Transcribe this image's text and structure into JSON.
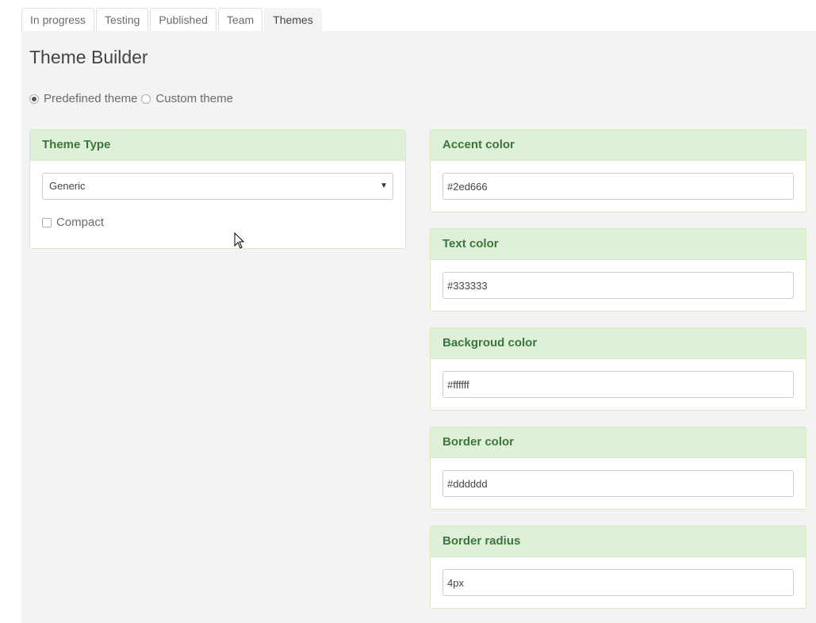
{
  "tabs": [
    {
      "label": "In progress",
      "active": false
    },
    {
      "label": "Testing",
      "active": false
    },
    {
      "label": "Published",
      "active": false
    },
    {
      "label": "Team",
      "active": false
    },
    {
      "label": "Themes",
      "active": true
    }
  ],
  "page_title": "Theme Builder",
  "theme_mode": {
    "options": [
      "Predefined theme",
      "Custom theme"
    ],
    "selected": "Predefined theme"
  },
  "theme_type_panel": {
    "title": "Theme Type",
    "select_value": "Generic",
    "compact_label": "Compact",
    "compact_checked": false
  },
  "color_panels": [
    {
      "title": "Accent color",
      "value": "#2ed666"
    },
    {
      "title": "Text color",
      "value": "#333333"
    },
    {
      "title": "Backgroud color",
      "value": "#ffffff"
    },
    {
      "title": "Border color",
      "value": "#dddddd"
    },
    {
      "title": "Border radius",
      "value": "4px"
    }
  ],
  "colors": {
    "panel_heading_bg": "#dff0d8",
    "panel_heading_text": "#3c763d",
    "panel_border": "#d6e9c6",
    "content_bg": "#f3f3f3"
  }
}
